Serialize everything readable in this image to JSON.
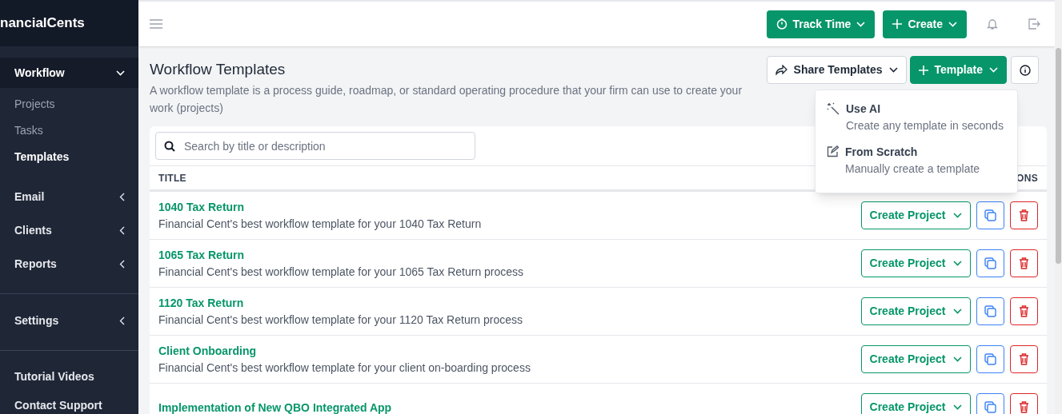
{
  "sidebar": {
    "logo": "nancialCents",
    "sections": [
      {
        "items": [
          {
            "label": "Workflow",
            "kind": "group",
            "expanded": true,
            "selected": true,
            "children": [
              {
                "label": "Projects",
                "selected": false
              },
              {
                "label": "Tasks",
                "selected": false
              },
              {
                "label": "Templates",
                "selected": true
              }
            ]
          },
          {
            "label": "Email",
            "kind": "group",
            "expanded": false,
            "selected": false
          },
          {
            "label": "Clients",
            "kind": "group",
            "expanded": false,
            "selected": false
          },
          {
            "label": "Reports",
            "kind": "group",
            "expanded": false,
            "selected": false
          }
        ]
      },
      {
        "items": [
          {
            "label": "Settings",
            "kind": "group",
            "expanded": false,
            "selected": false
          }
        ]
      },
      {
        "items": [
          {
            "label": "Tutorial Videos",
            "kind": "link"
          },
          {
            "label": "Contact Support",
            "kind": "link"
          }
        ]
      }
    ]
  },
  "header": {
    "buttons": [
      {
        "label": "Track Time"
      },
      {
        "label": "Create"
      }
    ]
  },
  "page": {
    "title": "Workflow Templates",
    "description": "A workflow template is a process guide, roadmap, or standard operating procedure that your firm can use to create your work (projects)",
    "actions": [
      {
        "label": "Share Templates",
        "kind": "outline"
      },
      {
        "label": "Template",
        "kind": "primary"
      }
    ]
  },
  "menu": {
    "items": [
      {
        "title": "Use AI",
        "subtitle": "Create any template in seconds"
      },
      {
        "title": "From Scratch",
        "subtitle": "Manually create a template"
      }
    ]
  },
  "table": {
    "search": {
      "placeholder": "Search by title or description"
    },
    "columns": [
      "TITLE",
      "ONS"
    ],
    "rows": [
      {
        "title": "1040 Tax Return",
        "description": "Financial Cent's best workflow template for your 1040 Tax Return",
        "action": "Create Project"
      },
      {
        "title": "1065 Tax Return",
        "description": "Financial Cent's best workflow template for your 1065 Tax Return process",
        "action": "Create Project"
      },
      {
        "title": "1120 Tax Return",
        "description": "Financial Cent's best workflow template for your 1120 Tax Return process",
        "action": "Create Project"
      },
      {
        "title": "Client Onboarding",
        "description": "Financial Cent's best workflow template for your client on-boarding process",
        "action": "Create Project"
      },
      {
        "title": "Implementation of New QBO Integrated App",
        "action": "Create Project"
      }
    ]
  }
}
